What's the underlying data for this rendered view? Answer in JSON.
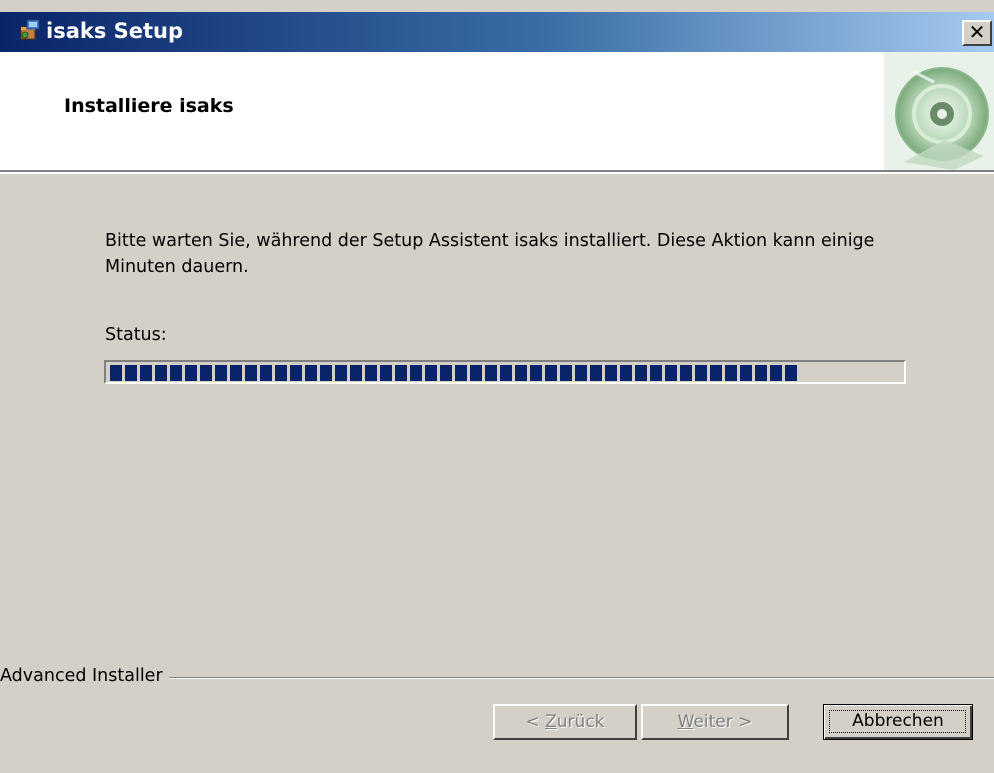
{
  "window": {
    "title": "isaks Setup",
    "close_glyph": "✕"
  },
  "banner": {
    "title": "Installiere isaks",
    "image_icon": "setup-disc-icon"
  },
  "body": {
    "description": "Bitte warten Sie, während der Setup Assistent isaks installiert. Diese Aktion kann einige Minuten dauern.",
    "status_label": "Status:",
    "progress_fraction": 0.88
  },
  "footer": {
    "brand": "Advanced Installer",
    "back": {
      "label_prefix": "< ",
      "mnemonic": "Z",
      "label_rest": "urück",
      "enabled": false
    },
    "next": {
      "mnemonic": "W",
      "label_rest": "eiter >",
      "enabled": false
    },
    "cancel": {
      "label": "Abbrechen",
      "enabled": true
    }
  },
  "colors": {
    "titlebar_start": "#0a246a",
    "titlebar_end": "#a6caf0",
    "progress_block": "#0a246a",
    "dialog_bg": "#d4d0c8"
  }
}
